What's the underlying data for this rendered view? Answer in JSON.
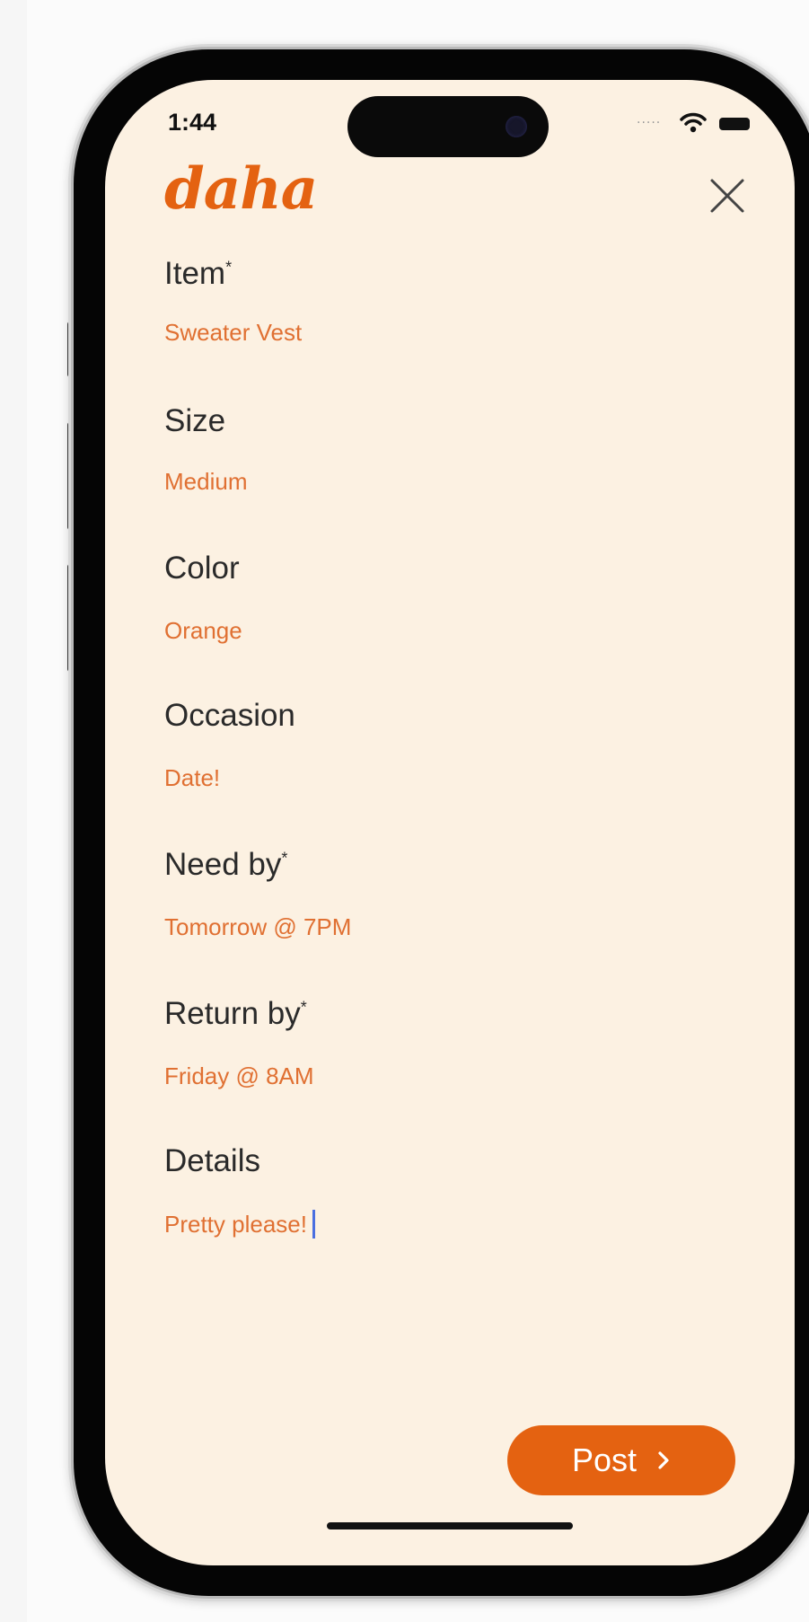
{
  "status_bar": {
    "time": "1:44",
    "signal_icon": "signal-dots-icon",
    "wifi_icon": "wifi-icon",
    "battery_icon": "battery-icon"
  },
  "header": {
    "logo": "daha",
    "close_icon": "close-icon"
  },
  "form": {
    "fields": [
      {
        "label": "Item",
        "required_mark": "*",
        "value": "Sweater Vest"
      },
      {
        "label": "Size",
        "required_mark": "",
        "value": "Medium"
      },
      {
        "label": "Color",
        "required_mark": "",
        "value": "Orange"
      },
      {
        "label": "Occasion",
        "required_mark": "",
        "value": "Date!"
      },
      {
        "label": "Need by",
        "required_mark": "*",
        "value": "Tomorrow @ 7PM"
      },
      {
        "label": "Return by",
        "required_mark": "*",
        "value": "Friday @ 8AM"
      },
      {
        "label": "Details",
        "required_mark": "",
        "value": "Pretty please!"
      }
    ]
  },
  "actions": {
    "post_label": "Post",
    "post_icon": "chevron-right-icon"
  },
  "colors": {
    "accent": "#e46211",
    "value_text": "#e07032",
    "background": "#fcf1e2",
    "label_text": "#2a2a2a",
    "caret": "#4a6fe0"
  }
}
